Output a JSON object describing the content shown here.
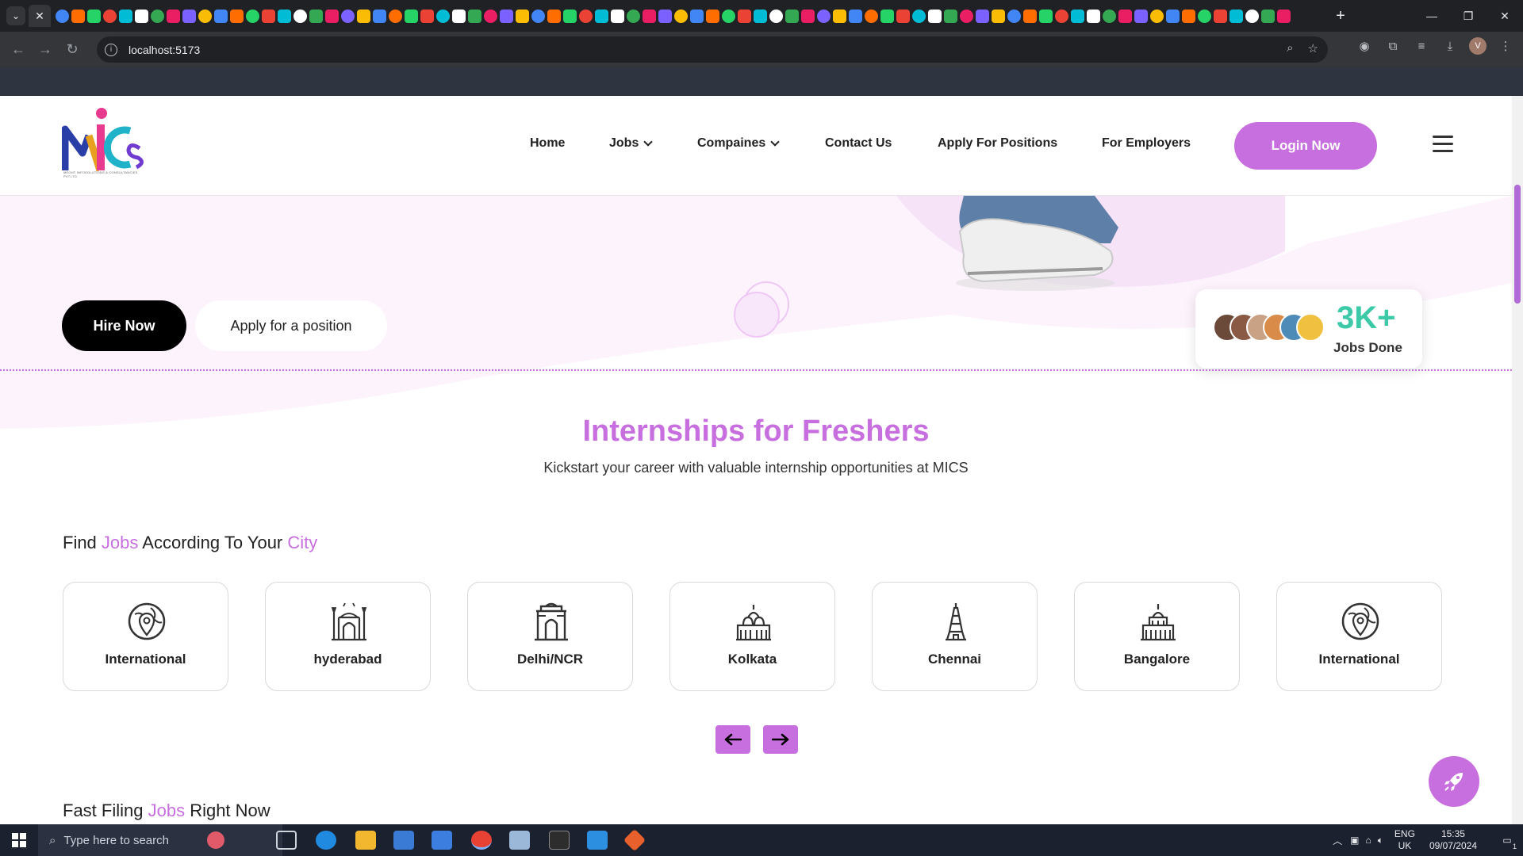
{
  "browser": {
    "url": "localhost:5173",
    "account_initial": "V"
  },
  "site": {
    "logo_letters": "MiCS",
    "logo_tagline": "MEGHT INFOSOLUTIONS & CONSULTANCIES PVT.LTD",
    "nav": {
      "home": "Home",
      "jobs": "Jobs",
      "companies": "Compaines",
      "contact": "Contact Us",
      "apply": "Apply For Positions",
      "employers": "For Employers"
    },
    "login": "Login Now"
  },
  "hero": {
    "hire": "Hire Now",
    "apply": "Apply for a position",
    "stat_value": "3K+",
    "stat_label": "Jobs Done"
  },
  "internships": {
    "title": "Internships for Freshers",
    "subtitle": "Kickstart your career with valuable internship opportunities at MICS"
  },
  "cities": {
    "heading_1": "Find ",
    "heading_2": "Jobs",
    "heading_3": " According To Your ",
    "heading_4": "City",
    "items": [
      {
        "name": "International",
        "icon": "globe-pin-icon"
      },
      {
        "name": "hyderabad",
        "icon": "charminar-icon"
      },
      {
        "name": "Delhi/NCR",
        "icon": "india-gate-icon"
      },
      {
        "name": "Kolkata",
        "icon": "victoria-memorial-icon"
      },
      {
        "name": "Chennai",
        "icon": "temple-tower-icon"
      },
      {
        "name": "Bangalore",
        "icon": "vidhana-soudha-icon"
      },
      {
        "name": "International",
        "icon": "globe-pin-icon"
      }
    ]
  },
  "fast": {
    "heading_1": "Fast Filing ",
    "heading_2": "Jobs",
    "heading_3": " Right Now"
  },
  "taskbar": {
    "search_placeholder": "Type here to search",
    "lang_1": "ENG",
    "lang_2": "UK",
    "time": "15:35",
    "date": "09/07/2024",
    "notif_count": "1"
  },
  "colors": {
    "accent": "#c86fe0",
    "stat": "#3cc9a8",
    "hero_bg": "#fbeefc"
  }
}
